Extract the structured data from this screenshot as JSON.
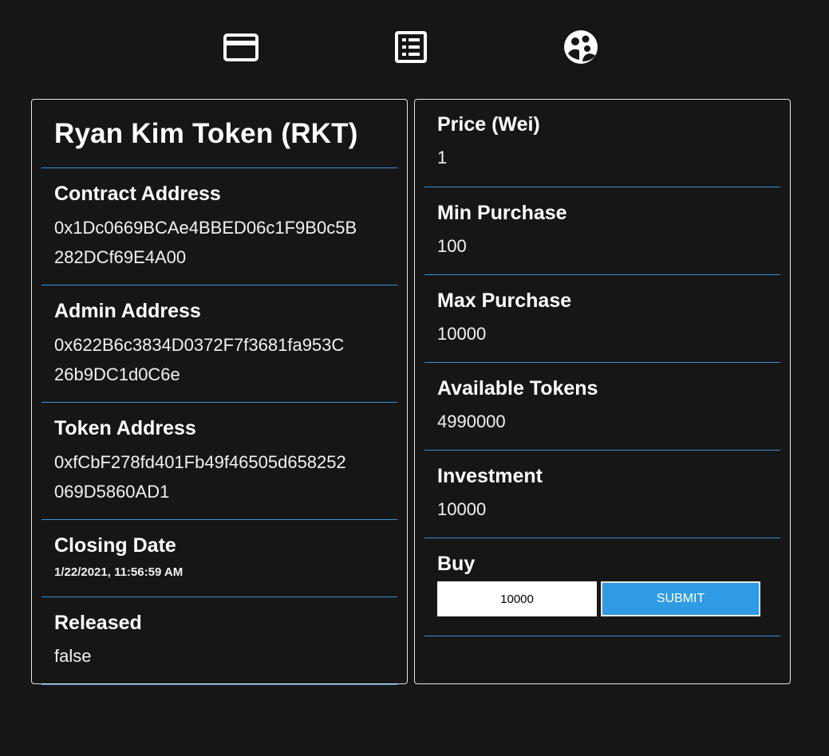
{
  "nav": {
    "items": [
      {
        "icon": "credit-card-icon"
      },
      {
        "icon": "list-icon"
      },
      {
        "icon": "people-icon"
      }
    ]
  },
  "token_info": {
    "title": "Ryan Kim Token (RKT)",
    "contract_address_label": "Contract Address",
    "contract_address_line1": "0x1Dc0669BCAe4BBED06c1F9B0c5B",
    "contract_address_line2": "282DCf69E4A00",
    "admin_address_label": "Admin Address",
    "admin_address_line1": "0x622B6c3834D0372F7f3681fa953C",
    "admin_address_line2": "26b9DC1d0C6e",
    "token_address_label": "Token Address",
    "token_address_line1": "0xfCbF278fd401Fb49f46505d658252",
    "token_address_line2": "069D5860AD1",
    "closing_date_label": "Closing Date",
    "closing_date": "1/22/2021, 11:56:59 AM",
    "released_label": "Released",
    "released": "false"
  },
  "sale_info": {
    "price_label": "Price (Wei)",
    "price": "1",
    "min_purchase_label": "Min Purchase",
    "min_purchase": "100",
    "max_purchase_label": "Max Purchase",
    "max_purchase": "10000",
    "available_tokens_label": "Available Tokens",
    "available_tokens": "4990000",
    "investment_label": "Investment",
    "investment": "10000",
    "buy_label": "Buy",
    "buy_input_value": "10000",
    "submit_label": "SUBMIT"
  },
  "colors": {
    "background": "#161616",
    "divider": "#3b8fd6",
    "submit": "#2f9be4",
    "text": "#ffffff"
  }
}
